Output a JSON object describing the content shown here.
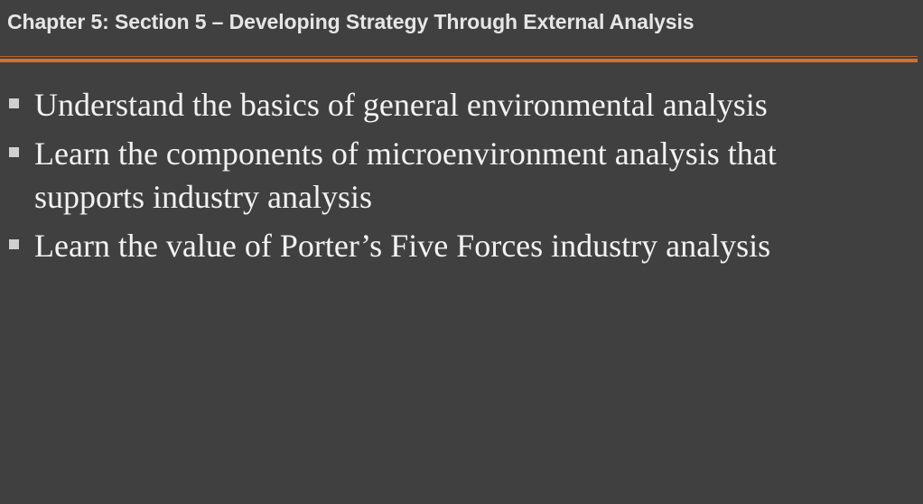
{
  "slide": {
    "title": "Chapter 5: Section 5 – Developing Strategy Through External Analysis",
    "bullets": [
      "Understand the basics of general environmental analysis",
      "Learn the components of microenvironment analysis that supports industry analysis",
      "Learn the value of Porter’s Five Forces industry analysis"
    ]
  },
  "colors": {
    "background": "#404040",
    "accent": "#d46f2e",
    "title_text": "#e6e6e6",
    "body_text": "#f2f2f2",
    "bullet_marker": "#d0d0d0"
  },
  "icons": {
    "bullet": "square-bullet-icon"
  }
}
